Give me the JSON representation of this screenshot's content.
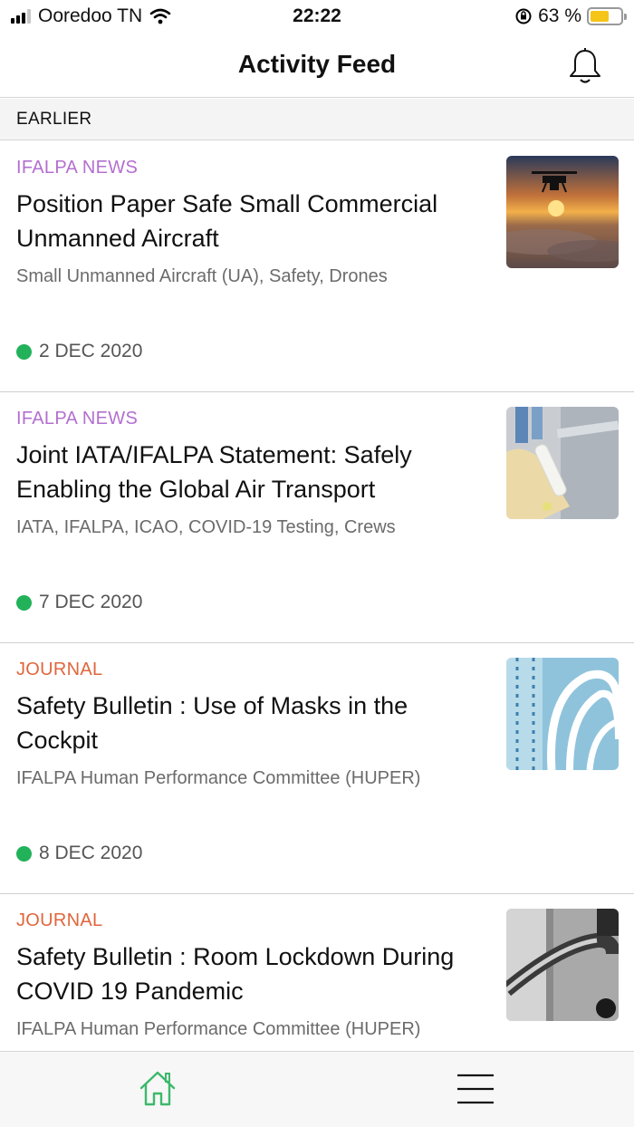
{
  "status_bar": {
    "carrier": "Ooredoo TN",
    "time": "22:22",
    "battery_percent": "63 %",
    "battery_level": 0.63,
    "battery_color": "#f5c518"
  },
  "header": {
    "title": "Activity Feed",
    "icon": "bell-icon"
  },
  "section": {
    "label": "EARLIER"
  },
  "colors": {
    "news_category": "#b36fd0",
    "journal_category": "#e0663c",
    "date_dot": "#22b25a",
    "home_active": "#3cb96b"
  },
  "feed": [
    {
      "category": "IFALPA NEWS",
      "category_type": "news",
      "title": "Position Paper Safe Small Commercial Unmanned Aircraft",
      "tags": "Small Unmanned Aircraft (UA), Safety, Drones",
      "date": "2 DEC 2020",
      "thumbnail": "drone-sunset-image"
    },
    {
      "category": "IFALPA NEWS",
      "category_type": "news",
      "title": "Joint IATA/IFALPA Statement: Safely Enabling the Global Air Transport",
      "tags": "IATA, IFALPA, ICAO, COVID-19 Testing, Crews",
      "date": "7 DEC 2020",
      "thumbnail": "test-tube-image"
    },
    {
      "category": "JOURNAL",
      "category_type": "journal",
      "title": "Safety Bulletin : Use of Masks in the Cockpit",
      "tags": "IFALPA Human Performance Committee (HUPER)",
      "date": "8 DEC 2020",
      "thumbnail": "face-masks-image"
    },
    {
      "category": "JOURNAL",
      "category_type": "journal",
      "title": "Safety Bulletin : Room Lockdown During COVID 19 Pandemic",
      "tags": "IFALPA Human Performance Committee (HUPER)",
      "date": "",
      "thumbnail": "door-handle-image"
    }
  ],
  "tab_bar": {
    "home_icon": "home-icon",
    "menu_icon": "menu-icon"
  }
}
